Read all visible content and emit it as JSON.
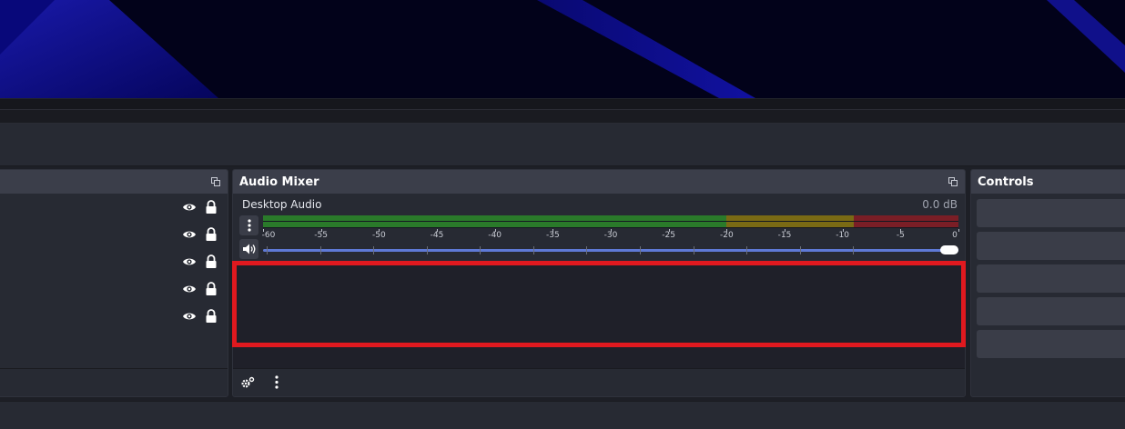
{
  "audio_mixer": {
    "title": "Audio Mixer",
    "source_name": "Desktop Audio",
    "volume_db": "0.0 dB",
    "meter_scale": [
      "-60",
      "-55",
      "-50",
      "-45",
      "-40",
      "-35",
      "-30",
      "-25",
      "-20",
      "-15",
      "-10",
      "-5",
      "0"
    ],
    "volume_level": 1.0,
    "colors": {
      "green": "#2a7a2a",
      "yellow": "#7a6a14",
      "red": "#7a1e26",
      "slider": "#5e79d6",
      "highlight": "#e0191f"
    }
  },
  "controls": {
    "title": "Controls",
    "button_count": 5
  },
  "sources": {
    "row_count": 5,
    "icons": [
      "eye-icon",
      "lock-icon"
    ]
  }
}
